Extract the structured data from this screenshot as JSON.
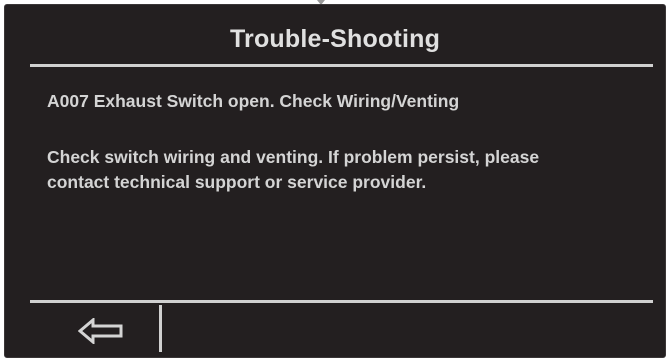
{
  "screen": {
    "title": "Trouble-Shooting",
    "error_line": "A007 Exhaust Switch open. Check Wiring/Venting",
    "message": "Check switch wiring and venting. If problem persist, please contact technical support or service provider."
  },
  "footer": {
    "back_icon": "back-arrow-icon"
  },
  "colors": {
    "background": "#231f20",
    "text": "#d4d4d4",
    "rule": "#d0d0d0"
  }
}
